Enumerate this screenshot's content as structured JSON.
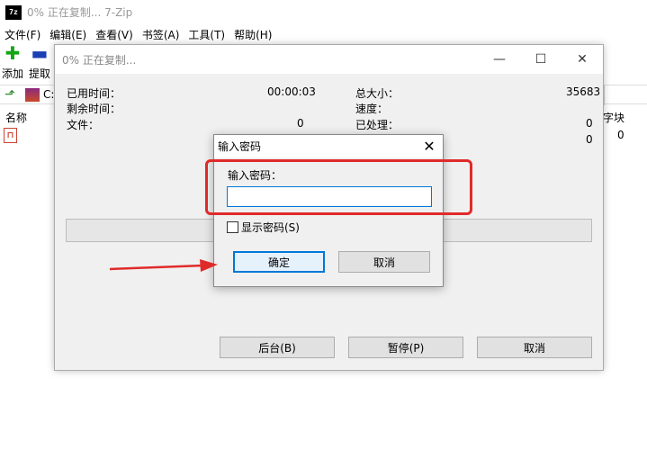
{
  "main_window": {
    "app_icon_text": "7z",
    "title": "0% 正在复制... 7-Zip",
    "menu": [
      "文件(F)",
      "编辑(E)",
      "查看(V)",
      "书签(A)",
      "工具(T)",
      "帮助(H)"
    ],
    "toolbar": {
      "add_label": "添加",
      "extract_label": "提取"
    },
    "address": "C:",
    "columns": {
      "name": "名称",
      "bytes": "字块"
    },
    "file_row": {
      "size": "0"
    }
  },
  "progress_dialog": {
    "title": "0% 正在复制...",
    "elapsed_label": "已用时间：",
    "elapsed_value": "00:00:03",
    "remaining_label": "剩余时间：",
    "files_label": "文件：",
    "files_value": "0",
    "total_size_label": "总大小：",
    "total_size_value": "35683",
    "speed_label": "速度：",
    "processed_label": "已处理：",
    "processed_value": "0",
    "extra_value": "0",
    "progress_fraction": 0.0,
    "buttons": {
      "background": "后台(B)",
      "pause": "暂停(P)",
      "cancel": "取消"
    }
  },
  "password_dialog": {
    "title": "输入密码",
    "prompt": "输入密码：",
    "input_value": "",
    "show_password_label": "显示密码(S)",
    "show_password_checked": false,
    "ok_label": "确定",
    "cancel_label": "取消"
  },
  "annotation_color": "#e02a2a"
}
